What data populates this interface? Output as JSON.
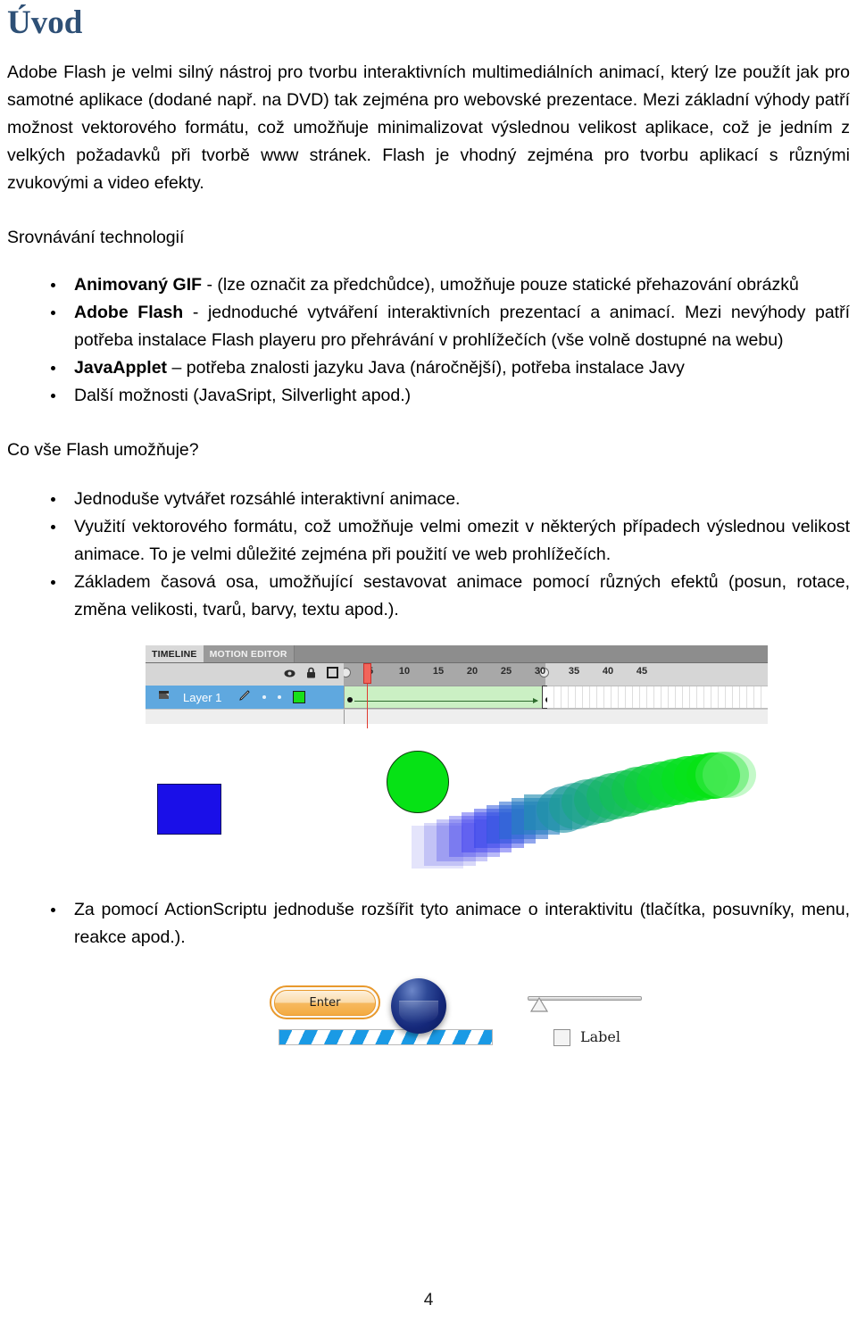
{
  "document": {
    "heading": "Úvod",
    "heading_color": "#2e5076",
    "page_number": "4"
  },
  "intro": {
    "paragraph": "Adobe Flash je velmi silný nástroj pro tvorbu interaktivních multimediálních animací, který lze použít jak pro samotné aplikace (dodané např. na DVD) tak zejména pro webovské prezentace. Mezi základní výhody patří možnost vektorového formátu, což umožňuje minimalizovat výslednou velikost aplikace, což je jedním z velkých požadavků při tvorbě www stránek. Flash je vhodný zejména pro tvorbu aplikací s různými zvukovými a video efekty."
  },
  "section_compare": {
    "lead": "Srovnávání technologií",
    "items": [
      {
        "bold": "Animovaný GIF",
        "rest": " - (lze označit za předchůdce), umožňuje pouze statické přehazování obrázků"
      },
      {
        "bold": "Adobe Flash",
        "rest": " - jednoduché vytváření interaktivních prezentací a animací. Mezi nevýhody patří potřeba instalace Flash playeru pro přehrávání v prohlížečích (vše volně dostupné na webu)"
      },
      {
        "bold": "JavaApplet",
        "rest": " – potřeba znalosti jazyku Java (náročnější), potřeba instalace Javy"
      },
      {
        "bold": "",
        "rest": "Další možnosti (JavaSript, Silverlight apod.)"
      }
    ]
  },
  "section_features": {
    "lead": "Co vše Flash umožňuje?",
    "items": [
      {
        "bold": "",
        "rest": "Jednoduše vytvářet rozsáhlé interaktivní animace."
      },
      {
        "bold": "",
        "rest": "Využití vektorového formátu, což umožňuje velmi omezit v některých případech výslednou velikost animace. To je velmi důležité zejména při použití ve web prohlížečích."
      },
      {
        "bold": "",
        "rest": "Základem časová osa, umožňující sestavovat animace pomocí různých efektů (posun, rotace, změna velikosti, tvarů, barvy, textu apod.)."
      }
    ]
  },
  "section_actionscript": {
    "items": [
      {
        "bold": "",
        "rest": "Za pomocí ActionScriptu jednoduše rozšířit tyto animace o interaktivitu (tlačítka, posuvníky, menu, reakce apod.)."
      }
    ]
  },
  "flash_timeline_figure": {
    "tabs": [
      {
        "label": "TIMELINE",
        "active": true
      },
      {
        "label": "MOTION EDITOR",
        "active": false
      }
    ],
    "header_icons": [
      "eye-icon",
      "lock-icon",
      "outline-square-icon"
    ],
    "layer": {
      "name": "Layer 1",
      "icons": [
        "folder-icon",
        "pencil-icon",
        "visible-dot-icon",
        "lock-dot-icon",
        "color-swatch-icon"
      ],
      "swatch_color": "#18e018"
    },
    "ruler": {
      "frame_labels": [
        "5",
        "10",
        "15",
        "20",
        "25",
        "30",
        "35",
        "40",
        "45"
      ],
      "playhead_frame": "4",
      "tween_start_frame": "1",
      "tween_end_frame": "30"
    },
    "stage": {
      "shapes": [
        {
          "name": "blue-square",
          "color": "#1a0fe8"
        },
        {
          "name": "green-circle",
          "color": "#06e215"
        },
        {
          "name": "motion-trail",
          "from_color": "#3333ee",
          "to_color": "#06e215"
        }
      ]
    }
  },
  "flash_components_figure": {
    "button_label": "Enter",
    "button_border_color": "#e8992d",
    "progress_bar": {
      "name": "progress-bar",
      "stripe_color": "#1a9ae5"
    },
    "round_button": {
      "name": "round-blue-button",
      "color": "#15287a"
    },
    "slider": {
      "name": "slider"
    },
    "checkbox_label": "Label"
  }
}
